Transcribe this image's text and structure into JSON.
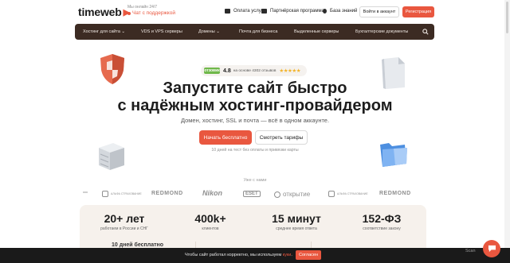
{
  "header": {
    "logo": "timeweb",
    "support_small": "Мы онлайн 24/7",
    "support_chat": "Чат с поддержкой",
    "links": [
      {
        "label": "Оплата услуг",
        "icon": "card-icon"
      },
      {
        "label": "Партнёрская программа",
        "icon": "handshake-icon"
      },
      {
        "label": "База знаний",
        "icon": "lightbulb-icon"
      }
    ],
    "login_label": "Войти в аккаунт",
    "register_label": "Регистрация"
  },
  "nav": {
    "items": [
      {
        "label": "Хостинг для сайта ⌄"
      },
      {
        "label": "VDS и VPS серверы"
      },
      {
        "label": "Домены ⌄"
      },
      {
        "label": "Почта для бизнеса"
      },
      {
        "label": "Выделенные серверы"
      },
      {
        "label": "Бухгалтерские документы"
      }
    ]
  },
  "rating": {
    "source": "отзовик",
    "value": "4.8",
    "text": "на основе 4302 отзывов",
    "stars": "★★★★★"
  },
  "hero": {
    "title_line1": "Запустите сайт быстро",
    "title_line2": "с надёжным хостинг-провайдером",
    "subtitle": "Домен, хостинг, SSL и почта — всё в одном аккаунте.",
    "start_label": "Начать бесплатно",
    "tariffs_label": "Смотреть тарифы",
    "trial_text": "10 дней на тест без оплаты и привязки карты"
  },
  "trusted": {
    "label": "Уже с нами",
    "brands": [
      {
        "name": "АЛЬФА СТРАХОВАНИЕ"
      },
      {
        "name": "REDMOND"
      },
      {
        "name": "Nikon"
      },
      {
        "name": "ESET"
      },
      {
        "name": "открытие"
      },
      {
        "name": "АЛЬФА СТРАХОВАНИЕ"
      },
      {
        "name": "REDMOND"
      }
    ]
  },
  "stats": [
    {
      "value": "20+ лет",
      "caption": "работаем в России и СНГ"
    },
    {
      "value": "400k+",
      "caption": "клиентов"
    },
    {
      "value": "15 минут",
      "caption": "среднее время ответа"
    },
    {
      "value": "152-ФЗ",
      "caption": "соответствие закону"
    }
  ],
  "stats_extra": "10 дней бесплатно",
  "cookie": {
    "text_before": "Чтобы сайт работал корректно, мы используем ",
    "link": "куки",
    "text_after": ".",
    "button": "Согласен"
  },
  "watermark": "Scan",
  "colors": {
    "accent": "#e9573f",
    "nav_bg": "#3c2b23",
    "stats_bg": "#f6f1ec",
    "cookie_bg": "#1a1a1a"
  }
}
